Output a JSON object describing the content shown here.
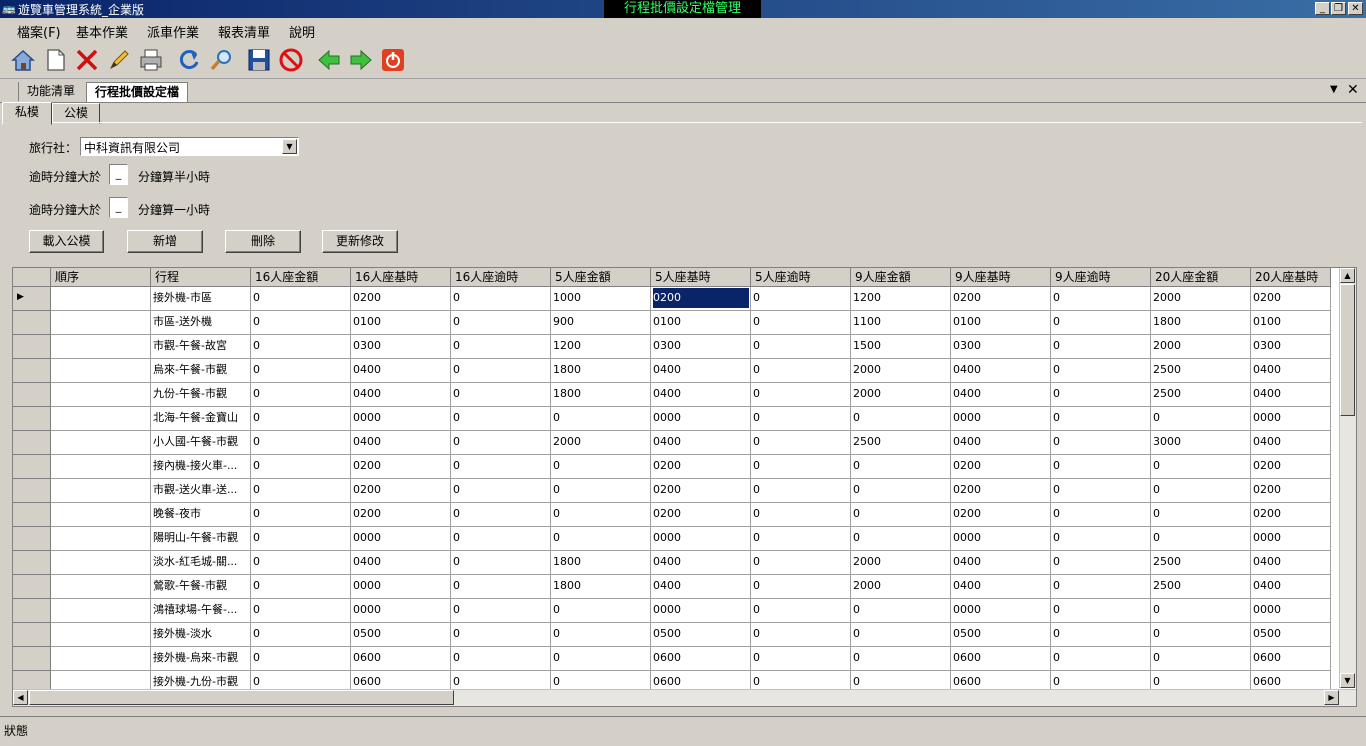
{
  "window": {
    "app_title": "遊覽車管理系統_企業版",
    "form_title": "行程批價設定檔管理",
    "min": "_",
    "max": "❐",
    "close": "✕"
  },
  "menu": [
    "檔案(F)",
    "基本作業",
    "派車作業",
    "報表清單",
    "說明"
  ],
  "doc_tabs": {
    "tab1": "功能清單",
    "tab2": "行程批價設定檔"
  },
  "inner_tabs": {
    "private": "私模",
    "public": "公模"
  },
  "form": {
    "agency_label": "旅行社：",
    "agency_value": "中科資訊有限公司",
    "overtime_label1": "逾時分鐘大於",
    "overtime_suffix1": "分鐘算半小時",
    "overtime_label2": "逾時分鐘大於",
    "overtime_suffix2": "分鐘算一小時",
    "btn_load": "載入公模",
    "btn_add": "新增",
    "btn_delete": "刪除",
    "btn_update": "更新修改"
  },
  "grid": {
    "columns": [
      "順序",
      "行程",
      "16人座金額",
      "16人座基時",
      "16人座逾時",
      "5人座金額",
      "5人座基時",
      "5人座逾時",
      "9人座金額",
      "9人座基時",
      "9人座逾時",
      "20人座金額",
      "20人座基時"
    ],
    "rows": [
      [
        "",
        "接外機-市區",
        "0",
        "0200",
        "0",
        "1000",
        "0200",
        "0",
        "1200",
        "0200",
        "0",
        "2000",
        "0200"
      ],
      [
        "",
        "市區-送外機",
        "0",
        "0100",
        "0",
        "900",
        "0100",
        "0",
        "1100",
        "0100",
        "0",
        "1800",
        "0100"
      ],
      [
        "",
        "市觀-午餐-故宮",
        "0",
        "0300",
        "0",
        "1200",
        "0300",
        "0",
        "1500",
        "0300",
        "0",
        "2000",
        "0300"
      ],
      [
        "",
        "烏來-午餐-市觀",
        "0",
        "0400",
        "0",
        "1800",
        "0400",
        "0",
        "2000",
        "0400",
        "0",
        "2500",
        "0400"
      ],
      [
        "",
        "九份-午餐-市觀",
        "0",
        "0400",
        "0",
        "1800",
        "0400",
        "0",
        "2000",
        "0400",
        "0",
        "2500",
        "0400"
      ],
      [
        "",
        "北海-午餐-金寶山",
        "0",
        "0000",
        "0",
        "0",
        "0000",
        "0",
        "0",
        "0000",
        "0",
        "0",
        "0000"
      ],
      [
        "",
        "小人國-午餐-市觀",
        "0",
        "0400",
        "0",
        "2000",
        "0400",
        "0",
        "2500",
        "0400",
        "0",
        "3000",
        "0400"
      ],
      [
        "",
        "接內機-接火車-...",
        "0",
        "0200",
        "0",
        "0",
        "0200",
        "0",
        "0",
        "0200",
        "0",
        "0",
        "0200"
      ],
      [
        "",
        "市觀-送火車-送...",
        "0",
        "0200",
        "0",
        "0",
        "0200",
        "0",
        "0",
        "0200",
        "0",
        "0",
        "0200"
      ],
      [
        "",
        "晚餐-夜市",
        "0",
        "0200",
        "0",
        "0",
        "0200",
        "0",
        "0",
        "0200",
        "0",
        "0",
        "0200"
      ],
      [
        "",
        "陽明山-午餐-市觀",
        "0",
        "0000",
        "0",
        "0",
        "0000",
        "0",
        "0",
        "0000",
        "0",
        "0",
        "0000"
      ],
      [
        "",
        "淡水-紅毛城-關...",
        "0",
        "0400",
        "0",
        "1800",
        "0400",
        "0",
        "2000",
        "0400",
        "0",
        "2500",
        "0400"
      ],
      [
        "",
        "鶯歌-午餐-市觀",
        "0",
        "0000",
        "0",
        "1800",
        "0400",
        "0",
        "2000",
        "0400",
        "0",
        "2500",
        "0400"
      ],
      [
        "",
        "鴻禧球場-午餐-...",
        "0",
        "0000",
        "0",
        "0",
        "0000",
        "0",
        "0",
        "0000",
        "0",
        "0",
        "0000"
      ],
      [
        "",
        "接外機-淡水",
        "0",
        "0500",
        "0",
        "0",
        "0500",
        "0",
        "0",
        "0500",
        "0",
        "0",
        "0500"
      ],
      [
        "",
        "接外機-烏來-市觀",
        "0",
        "0600",
        "0",
        "0",
        "0600",
        "0",
        "0",
        "0600",
        "0",
        "0",
        "0600"
      ],
      [
        "",
        "接外機-九份-市觀",
        "0",
        "0600",
        "0",
        "0",
        "0600",
        "0",
        "0",
        "0600",
        "0",
        "0",
        "0600"
      ]
    ]
  },
  "status": {
    "text": "狀態"
  },
  "icons": [
    "home-icon",
    "new-document-icon",
    "delete-icon",
    "edit-icon",
    "print-icon",
    "refresh-icon",
    "search-icon",
    "save-icon",
    "cancel-icon",
    "back-icon",
    "forward-icon",
    "exit-icon"
  ]
}
